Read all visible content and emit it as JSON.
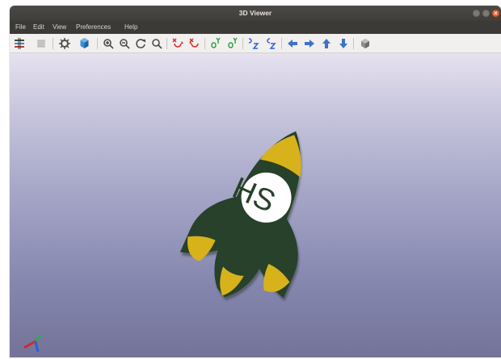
{
  "window": {
    "title": "3D Viewer"
  },
  "menu": {
    "items": [
      "File",
      "Edit",
      "View",
      "Preferences",
      "Help"
    ]
  },
  "toolbar": {
    "buttons": [
      "render-raytracing-icon",
      "render-realtime-icon",
      "preferences-icon",
      "3d-box-icon",
      "zoom-in-icon",
      "zoom-out-icon",
      "refresh-icon",
      "zoom-fit-icon",
      "rotate-x-cw-icon",
      "rotate-x-ccw-icon",
      "rotate-y-cw-icon",
      "rotate-y-ccw-icon",
      "rotate-z-cw-icon",
      "rotate-z-ccw-icon",
      "move-left-icon",
      "move-right-icon",
      "move-up-icon",
      "move-down-icon",
      "orthographic-icon"
    ]
  },
  "viewport": {
    "model": {
      "text": "HS",
      "body_color": "#27412a",
      "accent_color": "#d8b21b",
      "logo_fill": "#ffffff"
    },
    "axes": {
      "x_color": "#d12b2b",
      "y_color": "#2ea84b",
      "z_color": "#2e5fd1"
    }
  }
}
